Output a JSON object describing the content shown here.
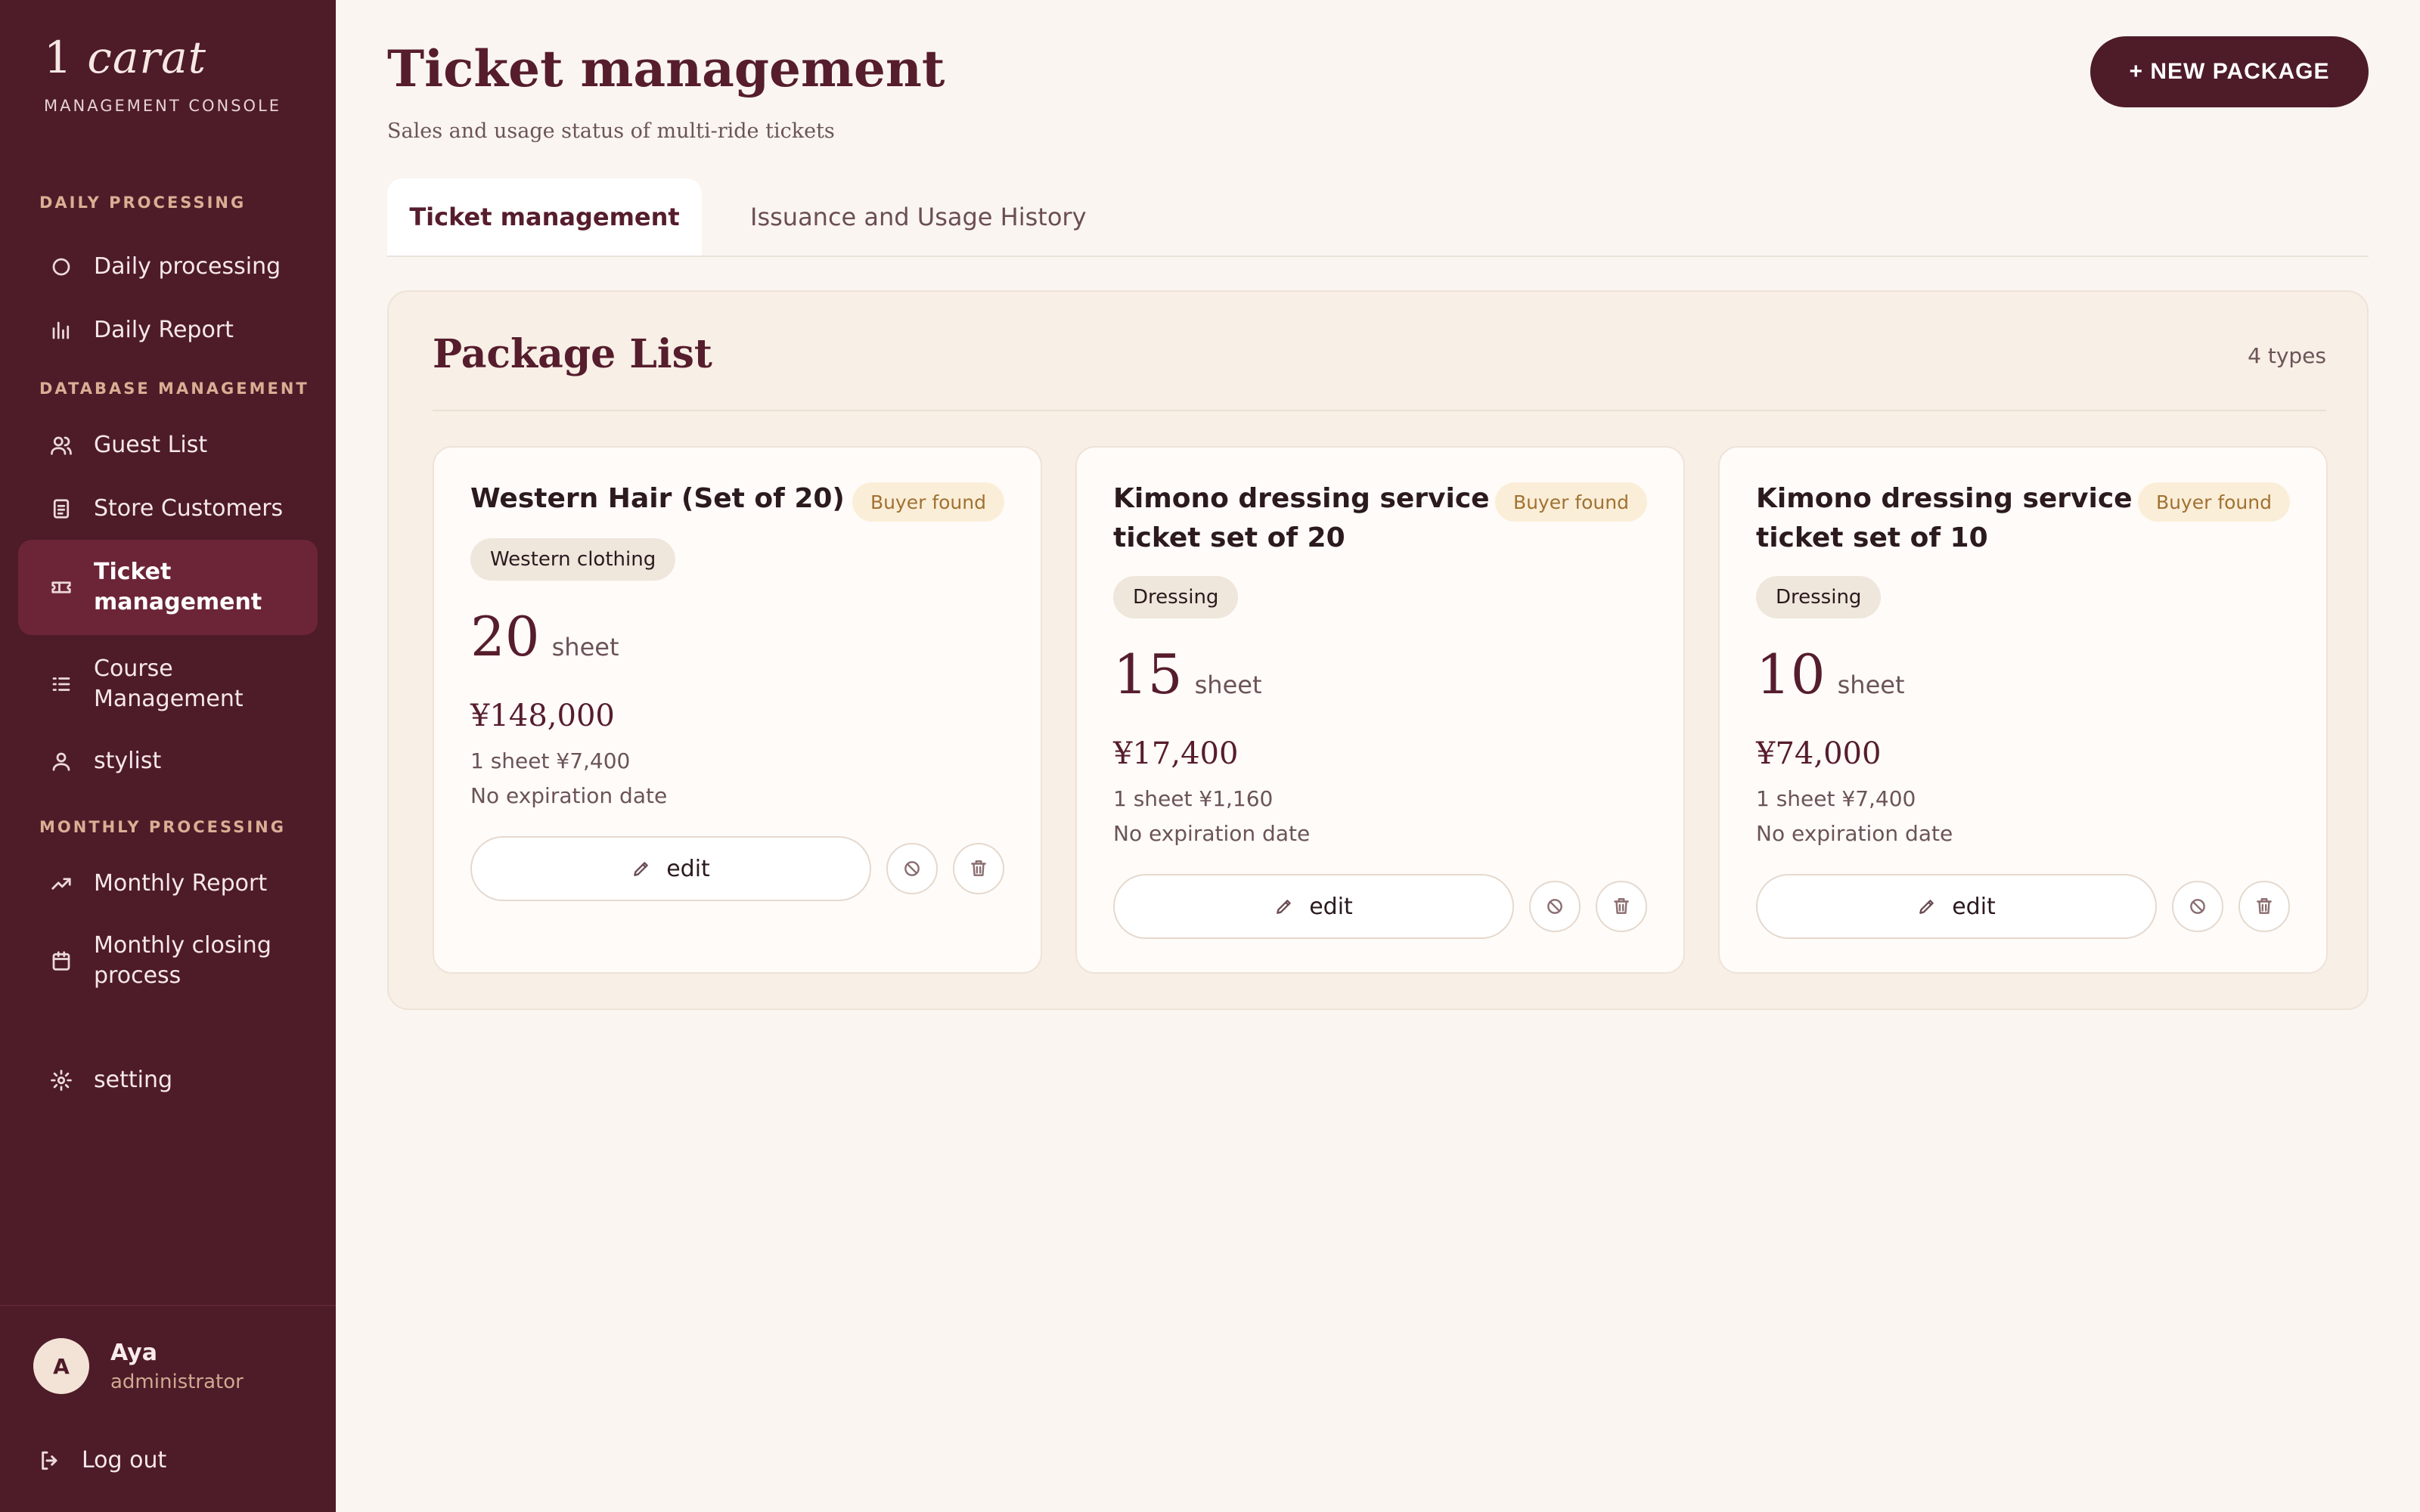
{
  "brand": {
    "logo_num": "1",
    "logo_word": "carat",
    "subtitle": "MANAGEMENT CONSOLE"
  },
  "sidebar": {
    "sections": [
      {
        "label": "DAILY PROCESSING"
      },
      {
        "label": "DATABASE MANAGEMENT"
      },
      {
        "label": "MONTHLY PROCESSING"
      }
    ],
    "items": [
      {
        "label": "Daily processing",
        "icon": "circle-icon"
      },
      {
        "label": "Daily Report",
        "icon": "bar-chart-icon"
      },
      {
        "label": "Guest List",
        "icon": "users-icon"
      },
      {
        "label": "Store Customers",
        "icon": "clipboard-icon"
      },
      {
        "label": "Ticket management",
        "icon": "ticket-icon",
        "active": true
      },
      {
        "label": "Course Management",
        "icon": "list-icon"
      },
      {
        "label": "stylist",
        "icon": "user-icon"
      },
      {
        "label": "Monthly Report",
        "icon": "trending-up-icon"
      },
      {
        "label": "Monthly closing process",
        "icon": "calendar-icon"
      },
      {
        "label": "setting",
        "icon": "gear-icon"
      }
    ],
    "user": {
      "initial": "A",
      "name": "Aya",
      "role": "administrator"
    },
    "logout_label": "Log out"
  },
  "header": {
    "title": "Ticket management",
    "subtitle": "Sales and usage status of multi-ride tickets",
    "new_button": "+ NEW PACKAGE"
  },
  "tabs": [
    {
      "label": "Ticket management",
      "active": true
    },
    {
      "label": "Issuance and Usage History",
      "active": false
    }
  ],
  "panel": {
    "title": "Package List",
    "count": "4 types",
    "cards": [
      {
        "title": "Western Hair (Set of 20)",
        "status": "Buyer found",
        "category": "Western clothing",
        "qty": "20",
        "unit": "sheet",
        "price": "¥148,000",
        "per_sheet": "1 sheet ¥7,400",
        "expiry": "No expiration date",
        "edit_label": "edit"
      },
      {
        "title": "Kimono dressing service ticket set of 20",
        "status": "Buyer found",
        "category": "Dressing",
        "qty": "15",
        "unit": "sheet",
        "price": "¥17,400",
        "per_sheet": "1 sheet ¥1,160",
        "expiry": "No expiration date",
        "edit_label": "edit"
      },
      {
        "title": "Kimono dressing service ticket set of 10",
        "status": "Buyer found",
        "category": "Dressing",
        "qty": "10",
        "unit": "sheet",
        "price": "¥74,000",
        "per_sheet": "1 sheet ¥7,400",
        "expiry": "No expiration date",
        "edit_label": "edit"
      }
    ]
  },
  "colors": {
    "sidebar_bg": "#4e1b29",
    "accent": "#561d2d",
    "active_nav": "#6c2537",
    "status_badge_bg": "#fbeed8",
    "status_badge_text": "#a07132",
    "page_bg": "#faf5f0"
  }
}
